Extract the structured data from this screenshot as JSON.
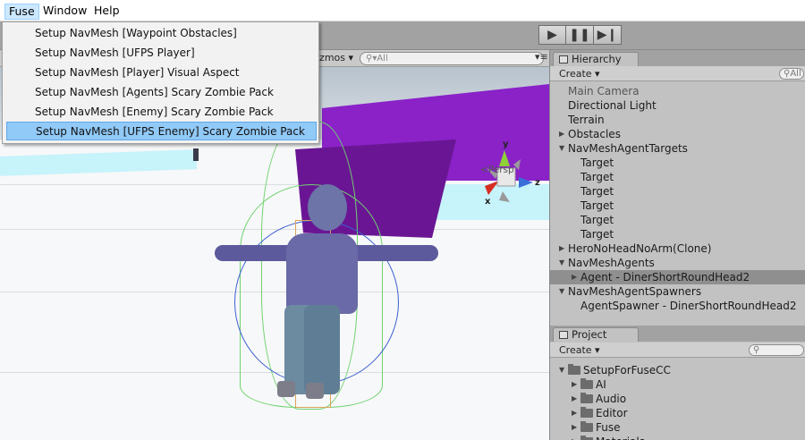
{
  "menubar": {
    "items": [
      "Fuse",
      "Window",
      "Help"
    ]
  },
  "dropdown": {
    "items": [
      "Setup NavMesh [Waypoint Obstacles]",
      "Setup NavMesh [UFPS Player]",
      "Setup NavMesh [Player] Visual Aspect",
      "Setup NavMesh [Agents] Scary Zombie Pack",
      "Setup NavMesh [Enemy] Scary Zombie Pack",
      "Setup NavMesh [UFPS Enemy] Scary Zombie Pack"
    ],
    "selected_index": 5
  },
  "playcontrols": {
    "play_icon": "play-icon",
    "pause_icon": "pause-icon",
    "step_icon": "step-icon"
  },
  "scene": {
    "gizmos_label": "izmos",
    "search_placeholder": "All",
    "persp_label": "Persp",
    "axis_y": "y",
    "axis_z": "z",
    "axis_x": "x"
  },
  "hierarchy": {
    "tab_label": "Hierarchy",
    "create_label": "Create",
    "search_placeholder": "All",
    "items": [
      {
        "label": "Main Camera",
        "depth": 0,
        "expander": "",
        "muted": true
      },
      {
        "label": "Directional Light",
        "depth": 0,
        "expander": ""
      },
      {
        "label": "Terrain",
        "depth": 0,
        "expander": ""
      },
      {
        "label": "Obstacles",
        "depth": 0,
        "expander": "right"
      },
      {
        "label": "NavMeshAgentTargets",
        "depth": 0,
        "expander": "down"
      },
      {
        "label": "Target",
        "depth": 1,
        "expander": ""
      },
      {
        "label": "Target",
        "depth": 1,
        "expander": ""
      },
      {
        "label": "Target",
        "depth": 1,
        "expander": ""
      },
      {
        "label": "Target",
        "depth": 1,
        "expander": ""
      },
      {
        "label": "Target",
        "depth": 1,
        "expander": ""
      },
      {
        "label": "Target",
        "depth": 1,
        "expander": ""
      },
      {
        "label": "HeroNoHeadNoArm(Clone)",
        "depth": 0,
        "expander": "right"
      },
      {
        "label": "NavMeshAgents",
        "depth": 0,
        "expander": "down"
      },
      {
        "label": "Agent - DinerShortRoundHead2",
        "depth": 1,
        "expander": "right",
        "selected": true
      },
      {
        "label": "NavMeshAgentSpawners",
        "depth": 0,
        "expander": "down"
      },
      {
        "label": "AgentSpawner - DinerShortRoundHead2",
        "depth": 1,
        "expander": ""
      }
    ]
  },
  "project": {
    "tab_label": "Project",
    "create_label": "Create",
    "items": [
      {
        "label": "SetupForFuseCC",
        "depth": 0,
        "expander": "down"
      },
      {
        "label": "AI",
        "depth": 1,
        "expander": "right"
      },
      {
        "label": "Audio",
        "depth": 1,
        "expander": "right"
      },
      {
        "label": "Editor",
        "depth": 1,
        "expander": "right"
      },
      {
        "label": "Fuse",
        "depth": 1,
        "expander": "right"
      },
      {
        "label": "Materials",
        "depth": 1,
        "expander": "right"
      }
    ]
  },
  "colors": {
    "menu_highlight": "#cce8ff",
    "dropdown_selected": "#91c9f7",
    "scene_purple": "#8a22c8",
    "panel_bg": "#c2c2c2",
    "selected_row": "#8f8f8f"
  }
}
